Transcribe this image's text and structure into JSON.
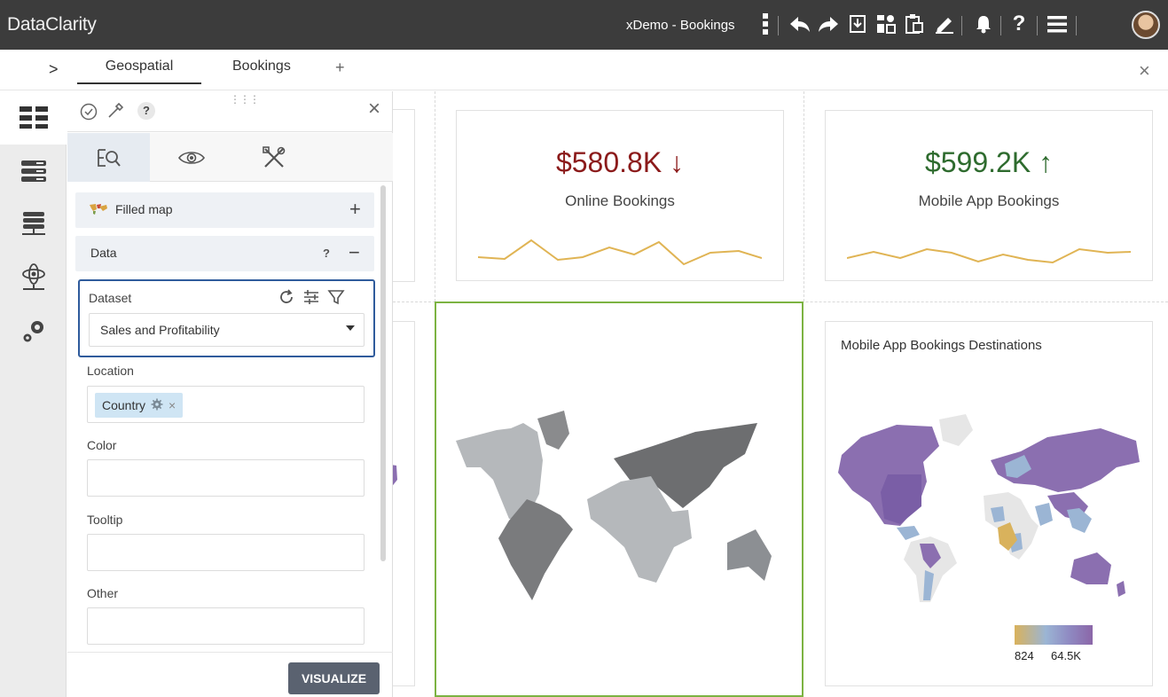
{
  "app": {
    "brand": "DataClarity",
    "document_title": "xDemo - Bookings"
  },
  "toolbar": {
    "icons": [
      "more-vert-icon",
      "undo-icon",
      "redo-icon",
      "save-icon",
      "widgets-icon",
      "clipboard-icon",
      "edit-icon",
      "bell-icon",
      "help-icon",
      "menu-icon",
      "avatar"
    ]
  },
  "tabs": {
    "toggle": ">",
    "items": [
      "Geospatial",
      "Bookings"
    ],
    "add": "+",
    "close": "×"
  },
  "rail": {
    "items": [
      "dashboards-icon",
      "datasets-icon",
      "data-sources-icon",
      "models-icon",
      "settings-icon"
    ]
  },
  "panel": {
    "header_icons": [
      "check-circle-icon",
      "eyedropper-icon",
      "help-icon"
    ],
    "close": "×",
    "tabs": [
      "query-icon",
      "view-icon",
      "tools-icon"
    ],
    "visualization": {
      "label": "Filled map",
      "action": "+"
    },
    "data_section": {
      "label": "Data",
      "help": "?",
      "collapse": "−"
    },
    "dataset": {
      "label": "Dataset",
      "value": "Sales and Profitability"
    },
    "location": {
      "label": "Location",
      "chip": "Country"
    },
    "color": {
      "label": "Color"
    },
    "tooltip": {
      "label": "Tooltip"
    },
    "other": {
      "label": "Other"
    },
    "visualize_button": "VISUALIZE"
  },
  "dashboard": {
    "kpis": [
      {
        "value": "$580.8K ↓",
        "label": "Online Bookings",
        "color": "#8b1a1a"
      },
      {
        "value": "$599.2K ↑",
        "label": "Mobile App Bookings",
        "color": "#2e6b2e"
      }
    ],
    "map_card": {
      "title": "Mobile App Bookings Destinations",
      "legend_min": "824",
      "legend_max": "64.5K"
    },
    "colors": {
      "sparkline": "#e0b454",
      "selection_border": "#7cb342",
      "dataset_highlight": "#2f5b9c"
    }
  }
}
